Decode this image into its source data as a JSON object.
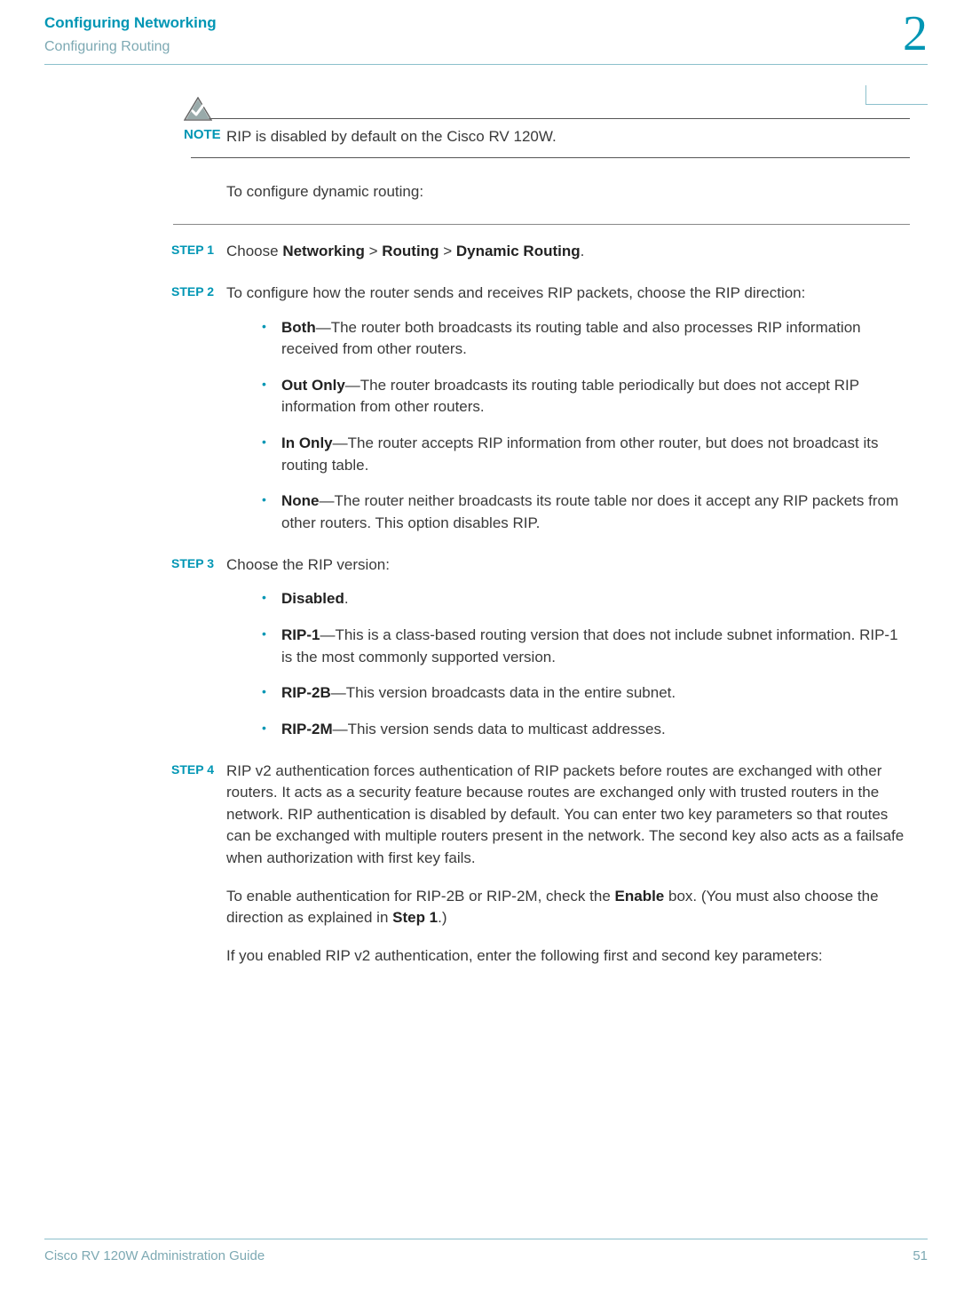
{
  "header": {
    "title": "Configuring Networking",
    "subtitle": "Configuring Routing",
    "chapter": "2"
  },
  "note": {
    "label": "NOTE",
    "text": "RIP is disabled by default on the Cisco RV 120W."
  },
  "intro": "To configure dynamic routing:",
  "steps": [
    {
      "label": "STEP  1",
      "pre": "Choose ",
      "b1": "Networking",
      "s1": " > ",
      "b2": "Routing",
      "s2": " > ",
      "b3": "Dynamic Routing",
      "post": "."
    },
    {
      "label": "STEP  2",
      "text": "To configure how the router sends and receives RIP packets, choose the RIP direction:",
      "bullets": [
        {
          "b": "Both",
          "t": "—The router both broadcasts its routing table and also processes RIP information received from other routers."
        },
        {
          "b": "Out Only",
          "t": "—The router broadcasts its routing table periodically but does not accept RIP information from other routers."
        },
        {
          "b": "In Only",
          "t": "—The router accepts RIP information from other router, but does not broadcast its routing table."
        },
        {
          "b": "None",
          "t": "—The router neither broadcasts its route table nor does it accept any RIP packets from other routers. This option disables RIP."
        }
      ]
    },
    {
      "label": "STEP  3",
      "text": "Choose the RIP version:",
      "bullets": [
        {
          "b": "Disabled",
          "t": "."
        },
        {
          "b": "RIP-1",
          "t": "—This is a class-based routing version that does not include subnet information. RIP-1 is the most commonly supported version."
        },
        {
          "b": "RIP-2B",
          "t": "—This version broadcasts data in the entire subnet."
        },
        {
          "b": "RIP-2M",
          "t": "—This version sends data to multicast addresses."
        }
      ]
    },
    {
      "label": "STEP  4",
      "text": "RIP v2 authentication forces authentication of RIP packets before routes are exchanged with other routers. It acts as a security feature because routes are exchanged only with trusted routers in the network. RIP authentication is disabled by default. You can enter two key parameters so that routes can be exchanged with multiple routers present in the network. The second key also acts as a failsafe when authorization with first key fails.",
      "para2_pre": "To enable authentication for RIP-2B or RIP-2M, check the ",
      "para2_b1": "Enable",
      "para2_mid": " box. (You must also choose the direction as explained in ",
      "para2_b2": "Step 1",
      "para2_post": ".)",
      "para3": "If you enabled RIP v2 authentication, enter the following first and second key parameters:"
    }
  ],
  "footer": {
    "left": "Cisco RV 120W Administration Guide",
    "right": "51"
  }
}
